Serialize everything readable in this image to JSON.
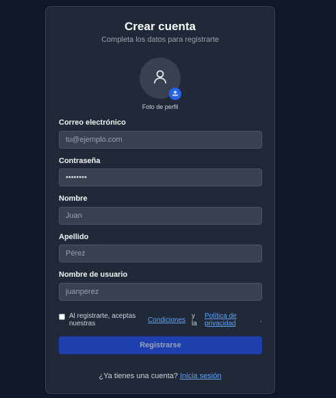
{
  "form": {
    "title": "Crear cuenta",
    "subtitle": "Completa los datos para registrarte",
    "photo_label": "Foto de perfil",
    "fields": [
      {
        "label": "Correo electrónico",
        "value": "",
        "placeholder": "tu@ejemplo.com",
        "type": "email"
      },
      {
        "label": "Contraseña",
        "value": "••••••••",
        "placeholder": "",
        "type": "password"
      },
      {
        "label": "Nombre",
        "value": "",
        "placeholder": "Juan",
        "type": "text"
      },
      {
        "label": "Apellido",
        "value": "",
        "placeholder": "Pérez",
        "type": "text"
      },
      {
        "label": "Nombre de usuario",
        "value": "",
        "placeholder": "juanperez",
        "type": "text"
      }
    ],
    "terms": {
      "checked": false,
      "prefix": "Al registrarte, aceptas nuestras",
      "conditions_link": "Condiciones",
      "conjunction": "y la",
      "privacy_link": "Política de privacidad",
      "suffix": "."
    },
    "submit_label": "Registrarse",
    "login_prompt": "¿Ya tienes una cuenta?",
    "login_link": "Inicia sesión"
  },
  "colors": {
    "background": "#111827",
    "card": "#1f2937",
    "input": "#374151",
    "accent": "#2563eb",
    "button": "#1e40af",
    "link": "#60a5fa"
  },
  "icons": {
    "avatar": "user-icon",
    "upload": "upload-icon"
  }
}
